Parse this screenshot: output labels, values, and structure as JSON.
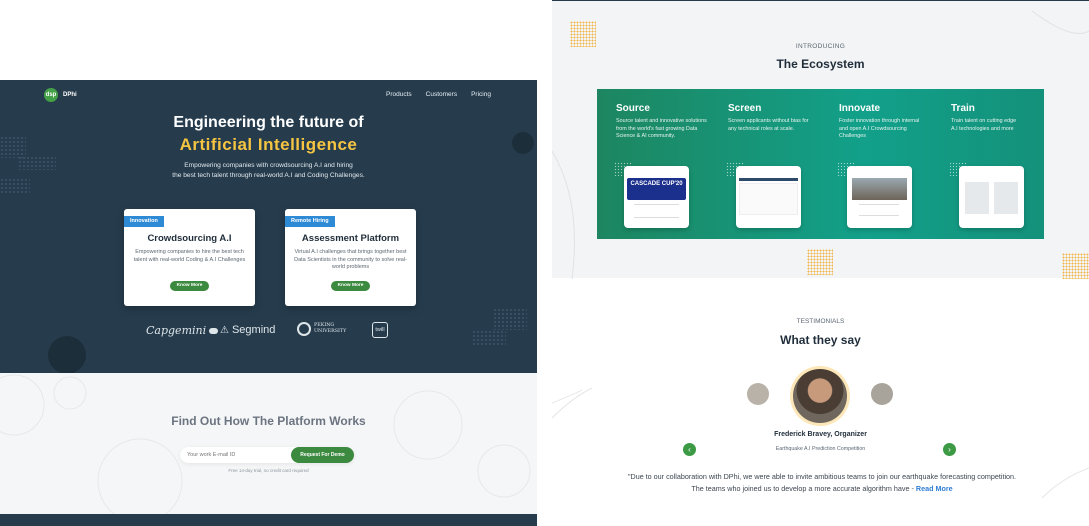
{
  "left": {
    "logo": {
      "badge": "dsp",
      "name": "DPhi"
    },
    "nav": [
      "Products",
      "Customers",
      "Pricing"
    ],
    "hero": {
      "title_line1": "Engineering the future of",
      "title_line2": "Artificial Intelligence",
      "subtitle_line1": "Empowering companies with crowdsourcing A.I and hiring",
      "subtitle_line2": "the best tech talent through real-world A.I and Coding Challenges."
    },
    "cards": [
      {
        "tag": "Innovation",
        "title": "Crowdsourcing A.I",
        "desc": "Empowering companies to hire the best tech talent with real-world Coding & A.I Challenges",
        "button": "Know More"
      },
      {
        "tag": "Remote Hiring",
        "title": "Assessment Platform",
        "desc": "Virtual A.I challenges that brings together best Data Scientists in the community to solve real-world problems",
        "button": "Know More"
      }
    ],
    "partners": [
      "Capgemini",
      "Segmind",
      "PEKING UNIVERSITY",
      "twill"
    ],
    "how": {
      "title": "Find Out How The Platform Works",
      "email_placeholder": "Your work E-mail ID",
      "button": "Request For Demo",
      "note": "Free 14-day trial, no credit card required"
    }
  },
  "right": {
    "ecosystem": {
      "intro": "INTRODUCING",
      "title": "The Ecosystem",
      "columns": [
        {
          "title": "Source",
          "desc": "Source talent and innovative solutions from the world's fast growing Data Science & AI community."
        },
        {
          "title": "Screen",
          "desc": "Screen applicants without bias for any technical roles at scale."
        },
        {
          "title": "Innovate",
          "desc": "Foster innovation through internal and open A.I Crowdsourcing Challenges"
        },
        {
          "title": "Train",
          "desc": "Train talent on cutting edge A.I technologies and more"
        }
      ],
      "thumb_text": [
        "CASCADE CUP'20"
      ]
    },
    "testimonials": {
      "label": "TESTIMONIALS",
      "title": "What they say",
      "name": "Frederick Bravey, Organizer",
      "competition": "Earthquake A.I Prediction Competition",
      "quote": "\"Due to our collaboration with DPhi, we were able to invite ambitious teams to join our earthquake forecasting competition. The teams who joined us to develop a more accurate algorithm have -",
      "read_more": "Read More"
    }
  },
  "colors": {
    "hero_bg": "#263c4d",
    "accent_yellow": "#f5c542",
    "green": "#3c8a3f",
    "teal": "#12a08a",
    "blue_tag": "#2f8ad6"
  }
}
